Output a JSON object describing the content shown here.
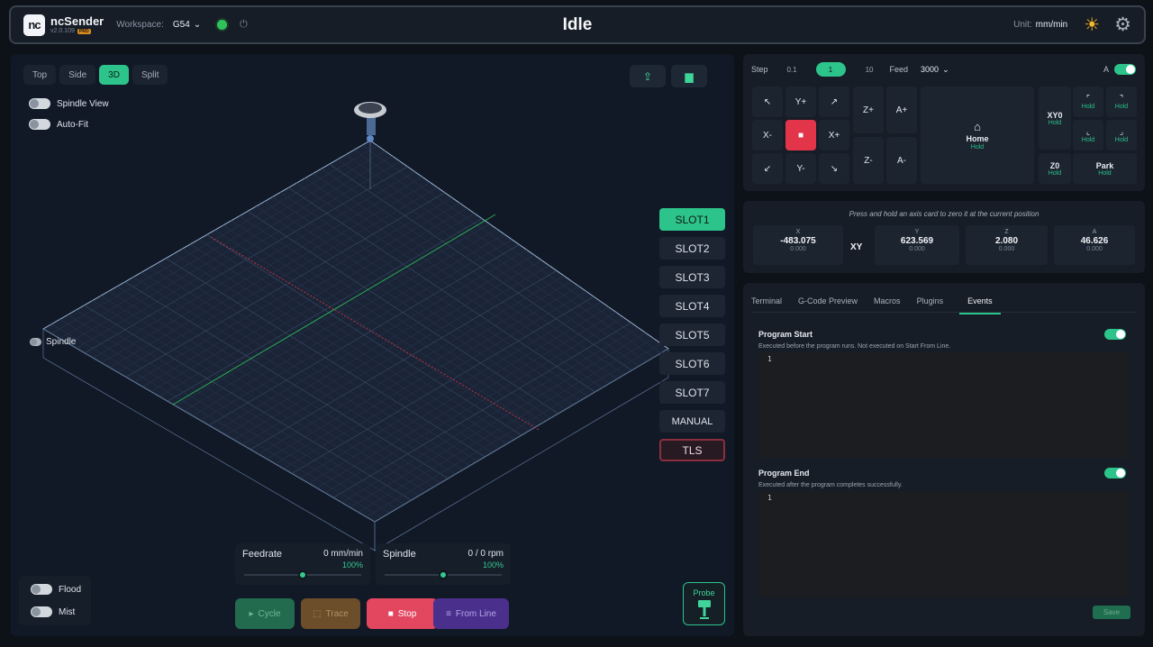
{
  "header": {
    "app_name": "ncSender",
    "version": "v2.0.109",
    "edition_badge": "PRO",
    "workspace_label": "Workspace:",
    "workspace_value": "G54",
    "state_title": "Idle",
    "unit_label": "Unit:",
    "unit_value": "mm/min",
    "status_color": "#2fc25b"
  },
  "viewer": {
    "view_tabs": [
      "Top",
      "Side",
      "3D",
      "Split"
    ],
    "active_view": "3D",
    "toggles": {
      "spindle_view": "Spindle View",
      "auto_fit": "Auto-Fit",
      "spindle": "Spindle"
    },
    "slots": [
      "SLOT1",
      "SLOT2",
      "SLOT3",
      "SLOT4",
      "SLOT5",
      "SLOT6",
      "SLOT7",
      "MANUAL",
      "TLS"
    ],
    "active_slot": "SLOT1",
    "feedrate": {
      "label": "Feedrate",
      "value": "0 mm/min",
      "percent": "100%",
      "slider_fraction": 0.5
    },
    "spindle": {
      "label": "Spindle",
      "value": "0 / 0 rpm",
      "percent": "100%",
      "slider_fraction": 0.5
    },
    "actions": {
      "cycle": "Cycle",
      "trace": "Trace",
      "stop": "Stop",
      "from_line": "From Line"
    },
    "probe_label": "Probe",
    "coolant": {
      "flood": "Flood",
      "mist": "Mist"
    }
  },
  "jog": {
    "step_label": "Step",
    "step_options": [
      "0.1",
      "1",
      "10"
    ],
    "active_step": "1",
    "feed_label": "Feed",
    "feed_value": "3000",
    "a_label": "A",
    "buttons": {
      "y_plus": "Y+",
      "y_minus": "Y-",
      "x_plus": "X+",
      "x_minus": "X-",
      "z_plus": "Z+",
      "z_minus": "Z-",
      "a_plus": "A+",
      "a_minus": "A-"
    },
    "home_label": "Home",
    "hold_label": "Hold",
    "xy0_label": "XY0",
    "z0_label": "Z0",
    "park_label": "Park"
  },
  "position": {
    "hint": "Press and hold an axis card to zero it at the current position",
    "xy_label": "XY",
    "axes": [
      {
        "name": "X",
        "value": "-483.075",
        "offset": "0.000"
      },
      {
        "name": "Y",
        "value": "623.569",
        "offset": "0.000"
      },
      {
        "name": "Z",
        "value": "2.080",
        "offset": "0.000"
      },
      {
        "name": "A",
        "value": "46.626",
        "offset": "0.000"
      }
    ]
  },
  "tabs": {
    "items": [
      "Terminal",
      "G-Code Preview",
      "Macros",
      "Plugins",
      "Events"
    ],
    "active": "Events"
  },
  "events": {
    "program_start": {
      "title": "Program Start",
      "desc": "Executed before the program runs. Not executed on Start From Line.",
      "line": "1"
    },
    "program_end": {
      "title": "Program End",
      "desc": "Executed after the program completes successfully.",
      "line": "1"
    },
    "save_label": "Save"
  },
  "colors": {
    "accent": "#2dc48b",
    "danger": "#e2475f",
    "x_axis": "#e0344b",
    "y_axis": "#2fc25b"
  }
}
